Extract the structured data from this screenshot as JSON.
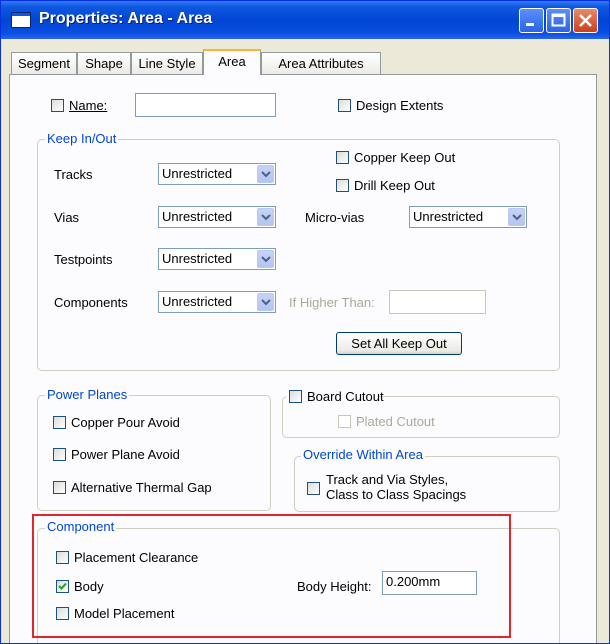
{
  "window": {
    "title": "Properties: Area - Area"
  },
  "tabs": [
    {
      "label": "Segment",
      "active": false
    },
    {
      "label": "Shape",
      "active": false
    },
    {
      "label": "Line Style",
      "active": false
    },
    {
      "label": "Area",
      "active": true
    },
    {
      "label": "Area Attributes",
      "active": false
    }
  ],
  "top": {
    "name_label": "Name:",
    "name_value": "",
    "design_extents_label": "Design Extents"
  },
  "keep": {
    "title": "Keep In/Out",
    "tracks_label": "Tracks",
    "tracks_value": "Unrestricted",
    "vias_label": "Vias",
    "vias_value": "Unrestricted",
    "testpoints_label": "Testpoints",
    "testpoints_value": "Unrestricted",
    "components_label": "Components",
    "components_value": "Unrestricted",
    "copper_keepout_label": "Copper  Keep Out",
    "drill_keepout_label": "Drill  Keep Out",
    "microvias_label": "Micro-vias",
    "microvias_value": "Unrestricted",
    "if_higher_label": "If Higher Than:",
    "if_higher_value": "",
    "set_all_label": "Set All Keep Out"
  },
  "power": {
    "title": "Power Planes",
    "copper_pour_avoid": "Copper Pour Avoid",
    "power_plane_avoid": "Power Plane Avoid",
    "alt_thermal_gap": "Alternative Thermal Gap"
  },
  "board": {
    "cutout_label": "Board Cutout",
    "plated_cutout_label": "Plated Cutout"
  },
  "override": {
    "title": "Override Within Area",
    "line1": "Track and Via Styles,",
    "line2": "Class to Class Spacings"
  },
  "component": {
    "title": "Component",
    "placement_clearance": "Placement Clearance",
    "body": "Body",
    "body_checked": true,
    "model_placement": "Model Placement",
    "body_height_label": "Body Height:",
    "body_height_value": "0.200mm"
  },
  "colors": {
    "group_title": "#0046d5",
    "highlight_box": "#e0262f",
    "titlebar": "#0046d6"
  }
}
